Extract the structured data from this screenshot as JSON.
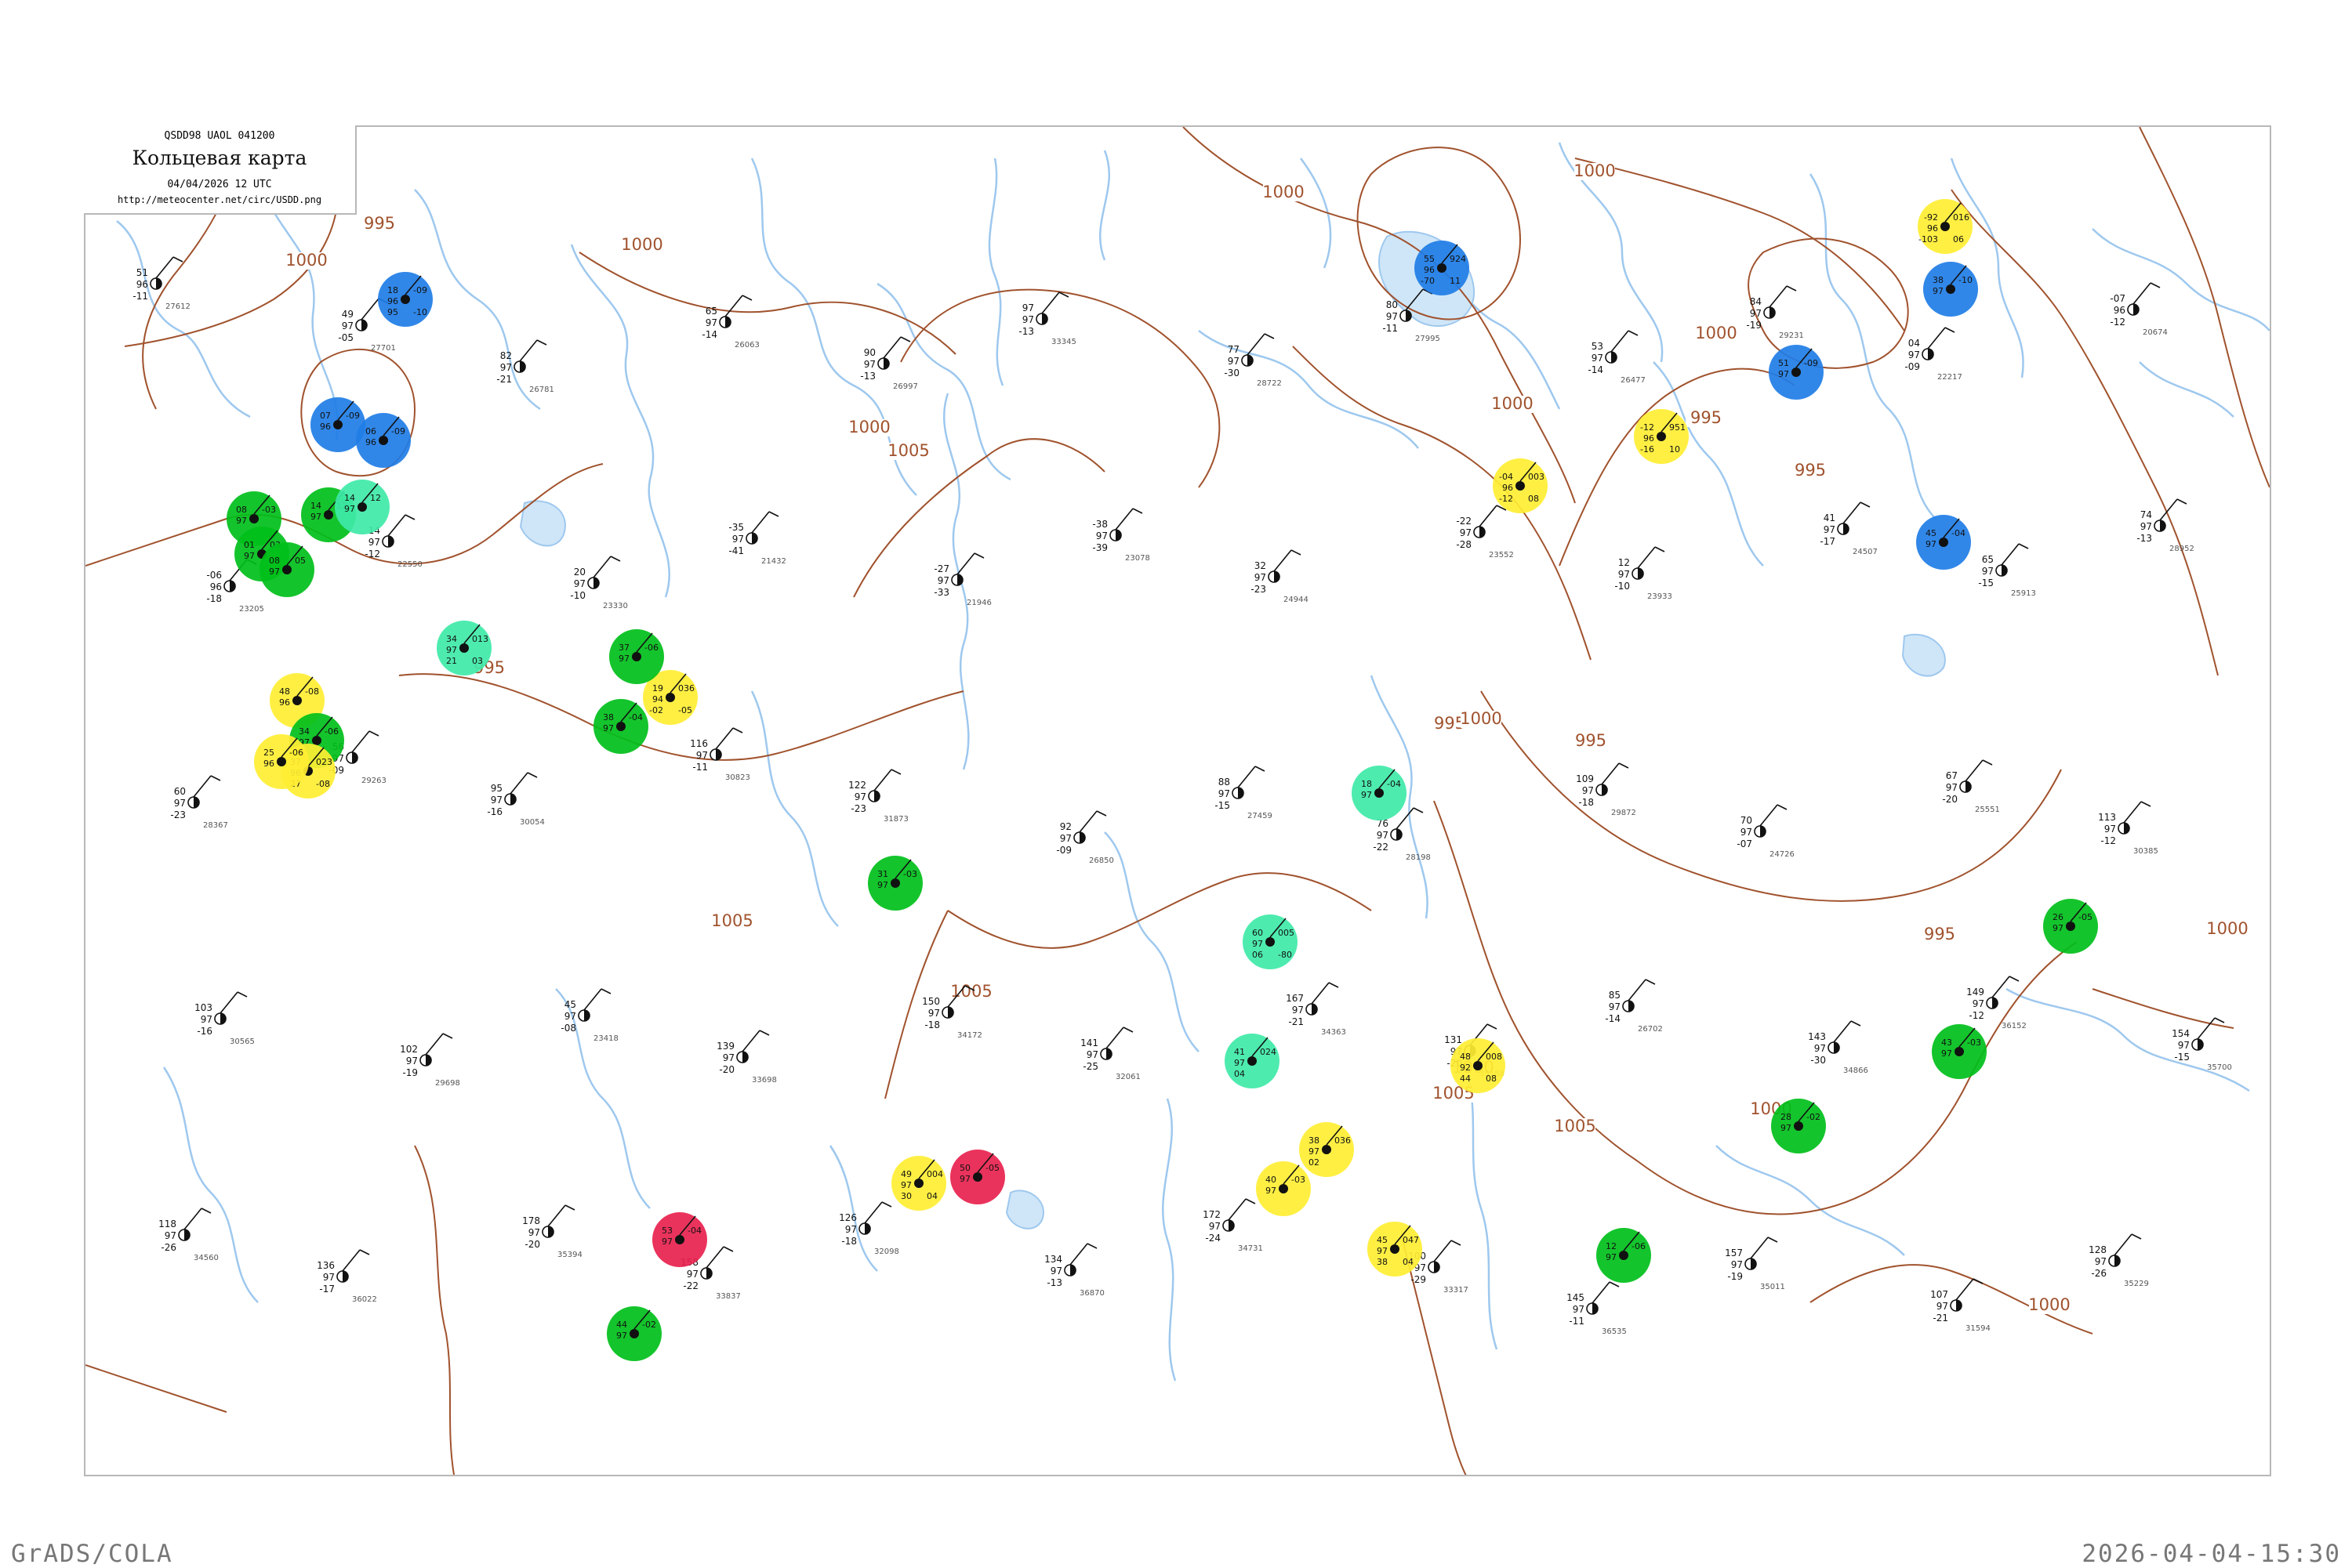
{
  "header": {
    "code_line": "QSDD98  UAOL  041200",
    "title": "Кольцевая карта",
    "datetime": "04/04/2026 12 UTC",
    "url": "http://meteocenter.net/circ/USDD.png"
  },
  "footer": {
    "left": "GrADS/COLA",
    "right": "2026-04-04-15:30"
  },
  "isobars": {
    "color": "#a0522d",
    "unit": "hPa",
    "labels": [
      "995",
      "1000",
      "1005"
    ]
  },
  "colors": {
    "rivers": "#9ec8ee",
    "station_text": "#111111",
    "station_name_text": "#555555",
    "highlight_green": "#00bf1a",
    "highlight_blue": "#1f7de6",
    "highlight_yellow": "#ffee33",
    "highlight_red": "#e8224e",
    "highlight_aqua": "#3fe9a8",
    "ring_green": "#33aa33"
  },
  "highlight_categories": [
    "green",
    "blue",
    "yellow",
    "red",
    "aqua",
    "green-ring"
  ],
  "highlighted_stations": [
    {
      "category": "blue",
      "values": [
        "18",
        "96",
        "-09",
        "95",
        "-10"
      ]
    },
    {
      "category": "blue",
      "values": [
        "07",
        "96",
        "-09"
      ]
    },
    {
      "category": "blue",
      "values": [
        "06",
        "96",
        "-09"
      ]
    },
    {
      "category": "green",
      "values": [
        "08",
        "97",
        "-03"
      ]
    },
    {
      "category": "green",
      "values": [
        "14",
        "97",
        "12"
      ]
    },
    {
      "category": "aqua",
      "values": [
        "14",
        "97",
        "12"
      ]
    },
    {
      "category": "green",
      "values": [
        "01",
        "97",
        "03"
      ]
    },
    {
      "category": "green",
      "values": [
        "08",
        "97",
        "05"
      ]
    },
    {
      "category": "aqua",
      "values": [
        "34",
        "97",
        "013",
        "21",
        "03"
      ]
    },
    {
      "category": "yellow",
      "values": [
        "48",
        "96",
        "-08"
      ]
    },
    {
      "category": "green",
      "values": [
        "34",
        "97",
        "-06"
      ]
    },
    {
      "category": "yellow",
      "values": [
        "37",
        "96",
        "023",
        "27",
        "-08"
      ]
    },
    {
      "category": "yellow",
      "values": [
        "25",
        "96",
        "-06"
      ]
    },
    {
      "category": "yellow",
      "values": [
        "19",
        "94",
        "036",
        "-02",
        "-05"
      ]
    },
    {
      "category": "green",
      "values": [
        "37",
        "97",
        "-06"
      ]
    },
    {
      "category": "green",
      "values": [
        "38",
        "97",
        "-04"
      ]
    },
    {
      "category": "green",
      "values": [
        "31",
        "97",
        "-03"
      ]
    },
    {
      "category": "green",
      "values": [
        "44",
        "97",
        "-02"
      ]
    },
    {
      "category": "red",
      "values": [
        "53",
        "97",
        "-04"
      ]
    },
    {
      "category": "red",
      "values": [
        "50",
        "97",
        "-05"
      ]
    },
    {
      "category": "yellow",
      "values": [
        "49",
        "97",
        "004",
        "30",
        "04"
      ]
    },
    {
      "category": "yellow",
      "values": [
        "38",
        "97",
        "036",
        "02"
      ]
    },
    {
      "category": "yellow",
      "values": [
        "45",
        "97",
        "047",
        "38",
        "04"
      ]
    },
    {
      "category": "yellow",
      "values": [
        "40",
        "97",
        "-03"
      ]
    },
    {
      "category": "yellow",
      "values": [
        "-04",
        "96",
        "003",
        "-12",
        "08"
      ]
    },
    {
      "category": "yellow",
      "values": [
        "-12",
        "96",
        "951",
        "-16",
        "10"
      ]
    },
    {
      "category": "yellow",
      "values": [
        "-92",
        "96",
        "016",
        "-103",
        "06"
      ]
    },
    {
      "category": "yellow",
      "values": [
        "48",
        "92",
        "008",
        "44",
        "08"
      ]
    },
    {
      "category": "aqua",
      "values": [
        "60",
        "97",
        "005",
        "06",
        "-80"
      ]
    },
    {
      "category": "aqua",
      "values": [
        "41",
        "97",
        "024",
        "04"
      ]
    },
    {
      "category": "aqua",
      "values": [
        "18",
        "97",
        "-04"
      ]
    },
    {
      "category": "blue",
      "values": [
        "55",
        "96",
        "924",
        "-70",
        "11"
      ]
    },
    {
      "category": "blue",
      "values": [
        "51",
        "97",
        "-09"
      ]
    },
    {
      "category": "blue",
      "values": [
        "38",
        "97",
        "-10"
      ]
    },
    {
      "category": "blue",
      "values": [
        "45",
        "97",
        "-04"
      ]
    },
    {
      "category": "green",
      "values": [
        "12",
        "97",
        "-06"
      ]
    },
    {
      "category": "green",
      "values": [
        "28",
        "97",
        "-02"
      ]
    },
    {
      "category": "green",
      "values": [
        "43",
        "97",
        "-03"
      ]
    },
    {
      "category": "green",
      "values": [
        "26",
        "97",
        "-05"
      ]
    }
  ],
  "contour_labels": [
    {
      "value": "995"
    },
    {
      "value": "995"
    },
    {
      "value": "995"
    },
    {
      "value": "995"
    },
    {
      "value": "995"
    },
    {
      "value": "995"
    },
    {
      "value": "995"
    },
    {
      "value": "1000"
    },
    {
      "value": "1000"
    },
    {
      "value": "1000"
    },
    {
      "value": "1000"
    },
    {
      "value": "1000"
    },
    {
      "value": "1000"
    },
    {
      "value": "1000"
    },
    {
      "value": "1000"
    },
    {
      "value": "1000"
    },
    {
      "value": "1000"
    },
    {
      "value": "1000"
    },
    {
      "value": "1000"
    },
    {
      "value": "1005"
    },
    {
      "value": "1005"
    },
    {
      "value": "1005"
    },
    {
      "value": "1005"
    },
    {
      "value": "1005"
    }
  ],
  "station_plots": [
    {
      "t": "51",
      "p": "96",
      "td": "-11",
      "n": "27612"
    },
    {
      "t": "49",
      "p": "97",
      "td": "-05",
      "n": "27701"
    },
    {
      "t": "82",
      "p": "97",
      "td": "-21",
      "n": "26781"
    },
    {
      "t": "65",
      "p": "97",
      "td": "-14",
      "n": "26063"
    },
    {
      "t": "90",
      "p": "97",
      "td": "-13",
      "n": "26997"
    },
    {
      "t": "97",
      "p": "97",
      "td": "-13",
      "n": "33345"
    },
    {
      "t": "77",
      "p": "97",
      "td": "-30",
      "n": "28722"
    },
    {
      "t": "80",
      "p": "97",
      "td": "-11",
      "n": "27995"
    },
    {
      "t": "53",
      "p": "97",
      "td": "-14",
      "n": "26477"
    },
    {
      "t": "84",
      "p": "97",
      "td": "-19",
      "n": "29231"
    },
    {
      "t": "04",
      "p": "97",
      "td": "-09",
      "n": "22217"
    },
    {
      "t": "-07",
      "p": "96",
      "td": "-12",
      "n": "20674"
    },
    {
      "t": "-06",
      "p": "96",
      "td": "-18",
      "n": "23205"
    },
    {
      "t": "14",
      "p": "97",
      "td": "-12",
      "n": "22550"
    },
    {
      "t": "20",
      "p": "97",
      "td": "-10",
      "n": "23330"
    },
    {
      "t": "-35",
      "p": "97",
      "td": "-41",
      "n": "21432"
    },
    {
      "t": "-27",
      "p": "97",
      "td": "-33",
      "n": "21946"
    },
    {
      "t": "-38",
      "p": "97",
      "td": "-39",
      "n": "23078"
    },
    {
      "t": "32",
      "p": "97",
      "td": "-23",
      "n": "24944"
    },
    {
      "t": "-22",
      "p": "97",
      "td": "-28",
      "n": "23552"
    },
    {
      "t": "12",
      "p": "97",
      "td": "-10",
      "n": "23933"
    },
    {
      "t": "41",
      "p": "97",
      "td": "-17",
      "n": "24507"
    },
    {
      "t": "65",
      "p": "97",
      "td": "-15",
      "n": "25913"
    },
    {
      "t": "74",
      "p": "97",
      "td": "-13",
      "n": "28952"
    },
    {
      "t": "60",
      "p": "97",
      "td": "-23",
      "n": "28367"
    },
    {
      "t": "56",
      "p": "97",
      "td": "-09",
      "n": "29263"
    },
    {
      "t": "95",
      "p": "97",
      "td": "-16",
      "n": "30054"
    },
    {
      "t": "116",
      "p": "97",
      "td": "-11",
      "n": "30823"
    },
    {
      "t": "122",
      "p": "97",
      "td": "-23",
      "n": "31873"
    },
    {
      "t": "92",
      "p": "97",
      "td": "-09",
      "n": "26850"
    },
    {
      "t": "88",
      "p": "97",
      "td": "-15",
      "n": "27459"
    },
    {
      "t": "76",
      "p": "97",
      "td": "-22",
      "n": "28198"
    },
    {
      "t": "109",
      "p": "97",
      "td": "-18",
      "n": "29872"
    },
    {
      "t": "70",
      "p": "97",
      "td": "-07",
      "n": "24726"
    },
    {
      "t": "67",
      "p": "97",
      "td": "-20",
      "n": "25551"
    },
    {
      "t": "113",
      "p": "97",
      "td": "-12",
      "n": "30385"
    },
    {
      "t": "103",
      "p": "97",
      "td": "-16",
      "n": "30565"
    },
    {
      "t": "102",
      "p": "97",
      "td": "-19",
      "n": "29698"
    },
    {
      "t": "45",
      "p": "97",
      "td": "-08",
      "n": "23418"
    },
    {
      "t": "139",
      "p": "97",
      "td": "-20",
      "n": "33698"
    },
    {
      "t": "150",
      "p": "97",
      "td": "-18",
      "n": "34172"
    },
    {
      "t": "141",
      "p": "97",
      "td": "-25",
      "n": "32061"
    },
    {
      "t": "167",
      "p": "97",
      "td": "-21",
      "n": "34363"
    },
    {
      "t": "131",
      "p": "97",
      "td": "-20",
      "n": "35188"
    },
    {
      "t": "85",
      "p": "97",
      "td": "-14",
      "n": "26702"
    },
    {
      "t": "143",
      "p": "97",
      "td": "-30",
      "n": "34866"
    },
    {
      "t": "149",
      "p": "97",
      "td": "-12",
      "n": "36152"
    },
    {
      "t": "154",
      "p": "97",
      "td": "-15",
      "n": "35700"
    },
    {
      "t": "118",
      "p": "97",
      "td": "-26",
      "n": "34560"
    },
    {
      "t": "136",
      "p": "97",
      "td": "-17",
      "n": "36022"
    },
    {
      "t": "178",
      "p": "97",
      "td": "-20",
      "n": "35394"
    },
    {
      "t": "158",
      "p": "97",
      "td": "-22",
      "n": "33837"
    },
    {
      "t": "126",
      "p": "97",
      "td": "-18",
      "n": "32098"
    },
    {
      "t": "134",
      "p": "97",
      "td": "-13",
      "n": "36870"
    },
    {
      "t": "172",
      "p": "97",
      "td": "-24",
      "n": "34731"
    },
    {
      "t": "100",
      "p": "97",
      "td": "-29",
      "n": "33317"
    },
    {
      "t": "145",
      "p": "97",
      "td": "-11",
      "n": "36535"
    },
    {
      "t": "157",
      "p": "97",
      "td": "-19",
      "n": "35011"
    },
    {
      "t": "107",
      "p": "97",
      "td": "-21",
      "n": "31594"
    },
    {
      "t": "128",
      "p": "97",
      "td": "-26",
      "n": "35229"
    }
  ]
}
